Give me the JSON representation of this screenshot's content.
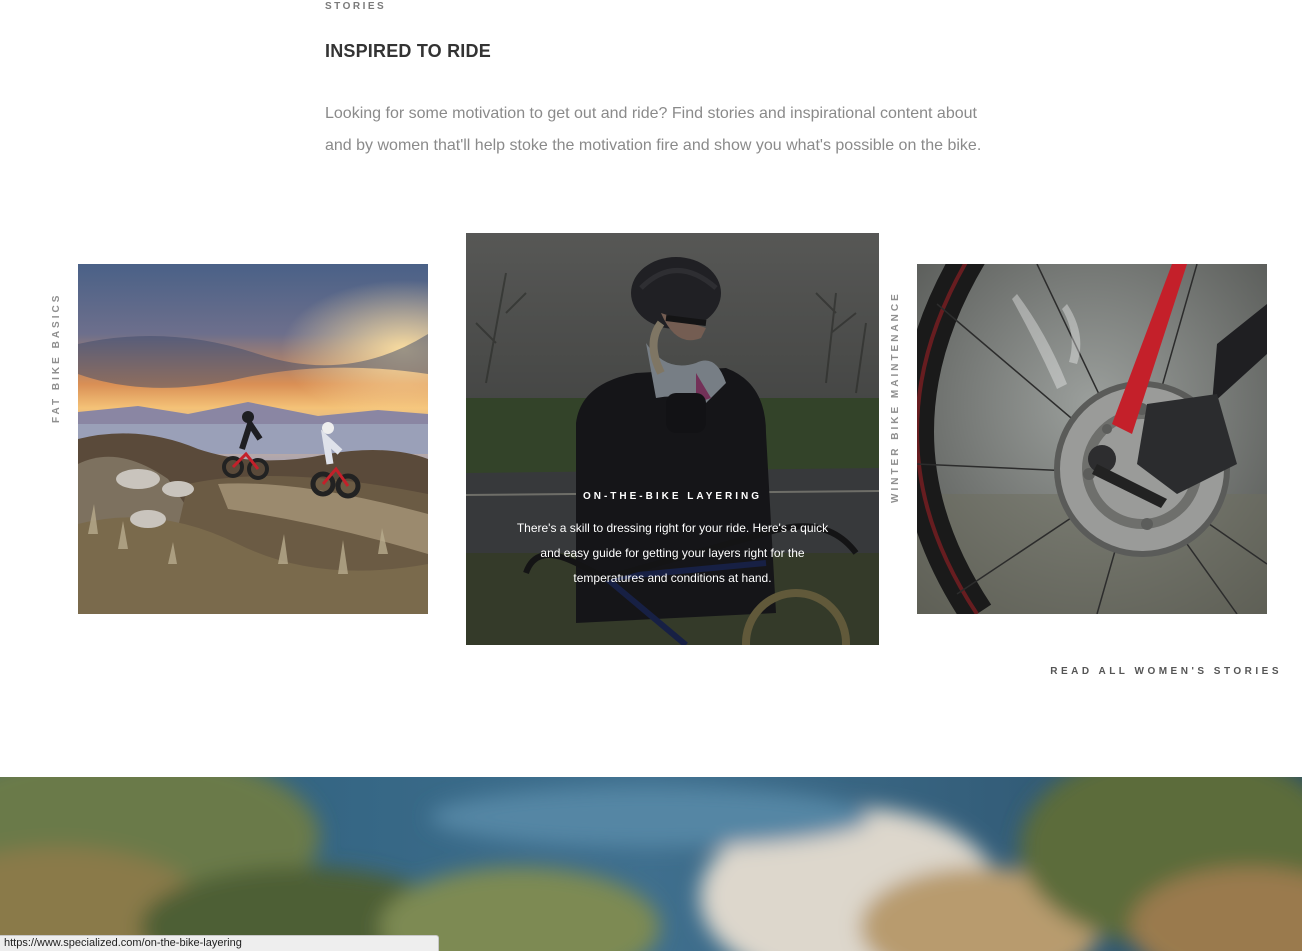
{
  "section": {
    "eyebrow": "STORIES",
    "title": "INSPIRED TO RIDE",
    "intro": "Looking for some motivation to get out and ride? Find stories and inspirational content about and by women that'll help stoke the motivation fire and show you what's possible on the bike."
  },
  "stories": [
    {
      "label": "FAT BIKE BASICS",
      "image": "fat-bike-riders-sunset"
    },
    {
      "label": "ON-THE-BIKE LAYERING",
      "description": "There's a skill to dressing right for your ride. Here's a quick and easy guide for getting your layers right for the temperatures and conditions at hand.",
      "image": "cyclist-adjusting-jacket"
    },
    {
      "label": "WINTER BIKE MAINTENANCE",
      "image": "disc-brake-closeup"
    }
  ],
  "read_all_label": "READ ALL WOMEN'S STORIES",
  "status_bar": {
    "url": "https://www.specialized.com/on-the-bike-layering"
  },
  "colors": {
    "heading": "#333333",
    "body_text": "#8a8a8a",
    "label": "#8f8f8f",
    "bike_red": "#c4202a"
  }
}
